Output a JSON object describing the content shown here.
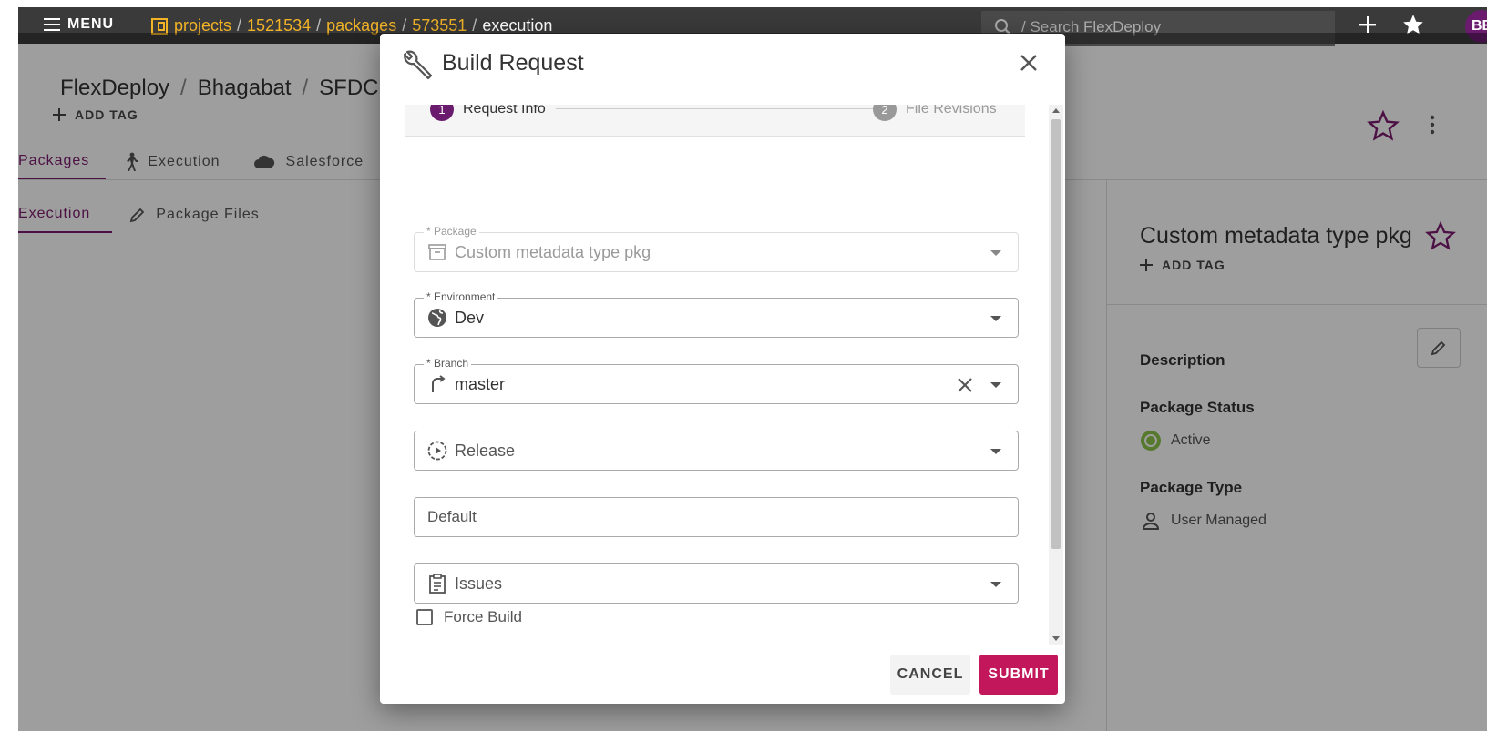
{
  "topbar": {
    "menu_label": "MENU",
    "breadcrumb": {
      "projects": "projects",
      "project_id": "1521534",
      "packages": "packages",
      "package_id": "573551",
      "current": "execution",
      "separator": "/"
    },
    "search_placeholder": "/ Search FlexDeploy",
    "avatar_initials": "BE"
  },
  "page": {
    "title_parts": [
      "FlexDeploy",
      "Bhagabat",
      "SFDC"
    ],
    "add_tag_label": "ADD TAG",
    "tabs": [
      {
        "label": "Packages",
        "active": true
      },
      {
        "label": "Execution",
        "active": false
      },
      {
        "label": "Salesforce",
        "active": false
      }
    ],
    "subtabs": [
      {
        "label": "Execution",
        "active": true
      },
      {
        "label": "Package Files",
        "active": false
      }
    ]
  },
  "side_panel": {
    "title": "Custom metadata type pkg",
    "add_tag_label": "ADD TAG",
    "description_label": "Description",
    "status_label": "Package Status",
    "status_value": "Active",
    "type_label": "Package Type",
    "type_value": "User Managed"
  },
  "dialog": {
    "title": "Build Request",
    "steps": [
      {
        "number": "1",
        "label": "Request Info",
        "active": true
      },
      {
        "number": "2",
        "label": "File Revisions",
        "active": false
      }
    ],
    "fields": {
      "package": {
        "label": "* Package",
        "value": "Custom metadata type pkg"
      },
      "environment": {
        "label": "* Environment",
        "value": "Dev"
      },
      "branch": {
        "label": "* Branch",
        "value": "master"
      },
      "release": {
        "placeholder": "Release"
      },
      "default": {
        "placeholder": "Default"
      },
      "issues": {
        "placeholder": "Issues"
      }
    },
    "force_build_label": "Force Build",
    "cancel_label": "CANCEL",
    "submit_label": "SUBMIT"
  },
  "colors": {
    "accent": "#7b1a6e",
    "submit": "#c2185b",
    "breadcrumb_link": "#f2b327",
    "topbar": "#3a3a3a",
    "status_active": "#8bc34a"
  }
}
